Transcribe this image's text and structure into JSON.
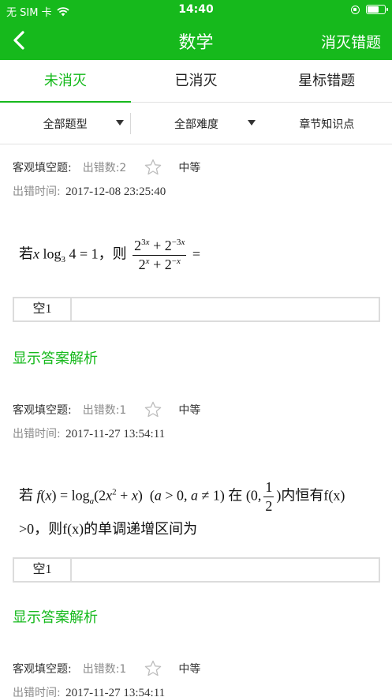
{
  "statusbar": {
    "carrier": "无 SIM 卡",
    "time": "14:40",
    "battery_level": 0.75
  },
  "navbar": {
    "title": "数学",
    "action_label": "消灭错题"
  },
  "tabs": [
    {
      "label": "未消灭",
      "active": true
    },
    {
      "label": "已消灭",
      "active": false
    },
    {
      "label": "星标错题",
      "active": false
    }
  ],
  "filters": [
    {
      "label": "全部题型"
    },
    {
      "label": "全部难度"
    },
    {
      "label": "章节知识点"
    }
  ],
  "questions": [
    {
      "type": "客观填空题:",
      "error_count": "出错数:2",
      "difficulty": "中等",
      "time_label": "出错时间:",
      "time_value": "2017-12-08 23:25:40",
      "stem_prefix": "若",
      "stem_then": "，则",
      "blank_label": "空1",
      "answer_link": "显示答案解析"
    },
    {
      "type": "客观填空题:",
      "error_count": "出错数:1",
      "difficulty": "中等",
      "time_label": "出错时间:",
      "time_value": "2017-11-27 13:54:11",
      "stem_prefix": "若",
      "stem_mid": "在",
      "stem_suffix": "内恒有f(x)",
      "stem_line2": ">0，则f(x)的单调递增区间为",
      "blank_label": "空1",
      "answer_link": "显示答案解析"
    },
    {
      "type": "客观填空题:",
      "error_count": "出错数:1",
      "difficulty": "中等",
      "time_label": "出错时间:",
      "time_value": "2017-11-27 13:54:11"
    }
  ],
  "icons": {
    "back": "chevron-left-icon",
    "star": "star-outline-icon",
    "wifi": "wifi-icon",
    "caret": "caret-down-icon"
  },
  "colors": {
    "brand_green": "#16b91c",
    "muted_text": "#8a8a8a",
    "border": "#dcdcdc"
  }
}
